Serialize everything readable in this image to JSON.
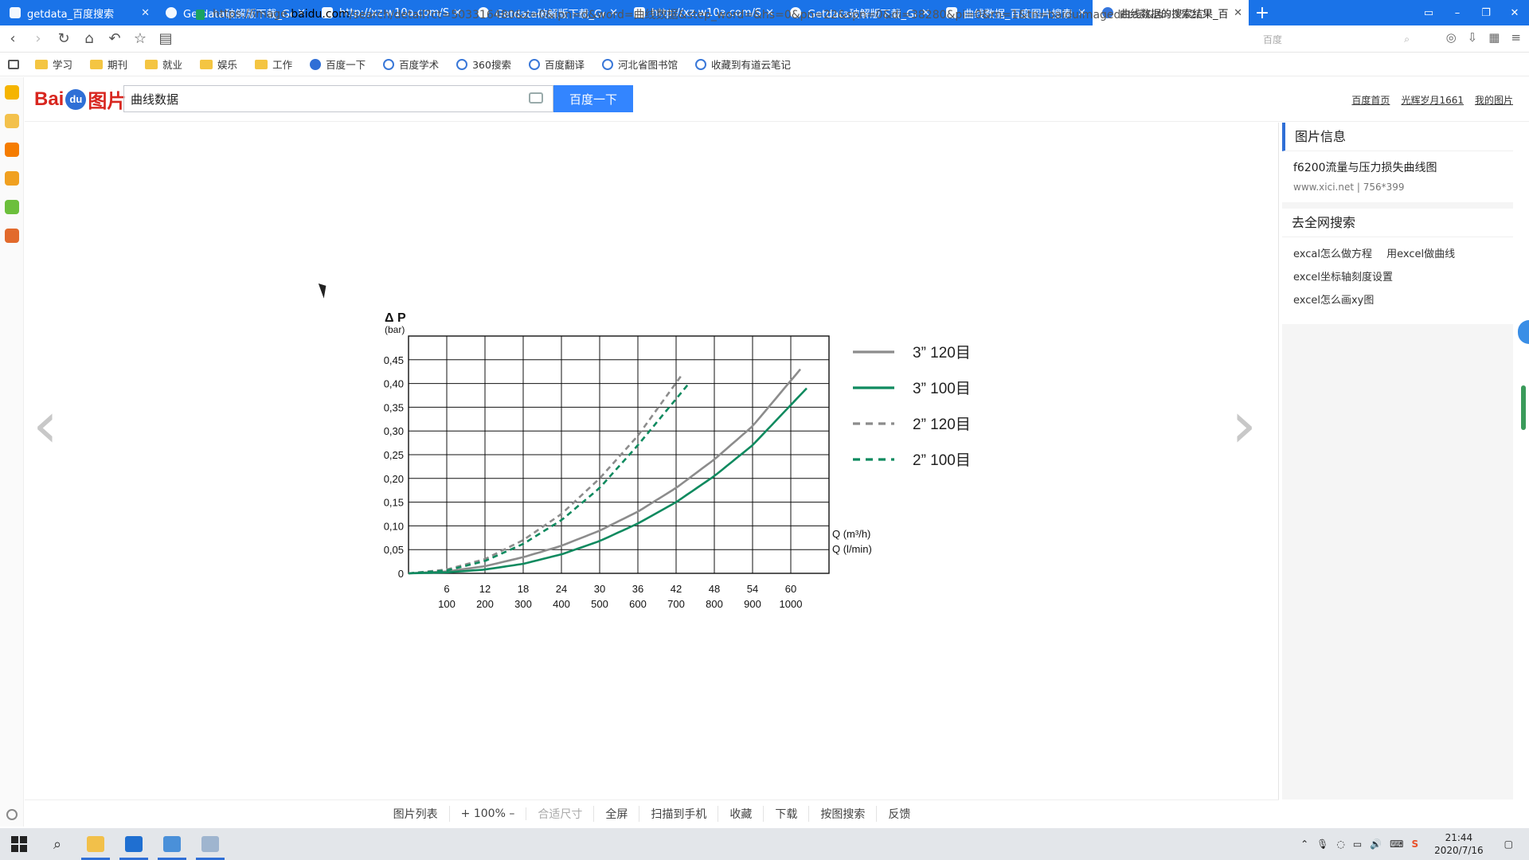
{
  "browser": {
    "tabs": [
      {
        "title": "getdata_百度搜索",
        "active": false
      },
      {
        "title": "Getdata破解版下载_Getd",
        "active": false
      },
      {
        "title": "http://xz.w10a.com/Small/g",
        "active": false
      },
      {
        "title": "Getdata破解版下载_Getd",
        "active": false
      },
      {
        "title": "http://xz.w10a.com/Small/g",
        "active": false
      },
      {
        "title": "Getdata破解版下载_Getd",
        "active": false
      },
      {
        "title": "曲线数据_百度图片搜索",
        "active": false
      },
      {
        "title": "曲线数据的搜索结果_百度",
        "active": true
      }
    ],
    "url_prefix": "https://image.",
    "url_domain": "baidu.com",
    "url_rest": "/search/detail?ct=503316480&z=0&ipn=d&word=曲线数据&step_word=&hs=0&pn=22&spn=0&di=38280&pi=0&rn=1&tn=baiduimagedetail&is=0%2C",
    "search_engine_box": "百度",
    "bookmarks": [
      "学习",
      "期刊",
      "就业",
      "娱乐",
      "工作",
      "百度一下",
      "百度学术",
      "360搜索",
      "百度翻译",
      "河北省图书馆",
      "收藏到有道云笔记"
    ]
  },
  "baidu": {
    "logo_bai": "Bai",
    "logo_du": "du",
    "logo_pic": "图片",
    "query": "曲线数据",
    "search_button": "百度一下",
    "links": [
      "百度首页",
      "光辉岁月1661",
      "我的图片"
    ]
  },
  "info_panel": {
    "title": "图片信息",
    "description": "f6200流量与压力损失曲线图",
    "source": "www.xici.net",
    "size": "756*399",
    "web_search_title": "去全网搜索",
    "suggestions": [
      [
        "excal怎么做方程",
        "用excel做曲线"
      ],
      [
        "excel坐标轴刻度设置"
      ],
      [
        "excel怎么画xy图"
      ]
    ]
  },
  "viewer_toolbar": [
    "图片列表",
    "+ 100% –",
    "合适尺寸",
    "全屏",
    "扫描到手机",
    "收藏",
    "下载",
    "按图搜索",
    "反馈"
  ],
  "taskbar": {
    "time": "21:44",
    "date": "2020/7/16"
  },
  "colors": {
    "tab_bar": "#1a73e8",
    "accent": "#3385ff",
    "gray_series": "#8c8c8c",
    "green_series": "#0f8a5f"
  },
  "chart_data": {
    "type": "line",
    "ylabel_symbol": "Δ P",
    "ylabel_unit": "(bar)",
    "yticks": [
      "0",
      "0,05",
      "0,10",
      "0,15",
      "0,20",
      "0,25",
      "0,30",
      "0,35",
      "0,40",
      "0,45"
    ],
    "ylim": [
      0,
      0.5
    ],
    "x_primary_ticks": [
      "6",
      "12",
      "18",
      "24",
      "30",
      "36",
      "42",
      "48",
      "54",
      "60"
    ],
    "x_primary_label": "Q (m³/h)",
    "x_secondary_ticks": [
      "100",
      "200",
      "300",
      "400",
      "500",
      "600",
      "700",
      "800",
      "900",
      "1000"
    ],
    "x_secondary_label": "Q (l/min)",
    "xlim": [
      0,
      66
    ],
    "grid": true,
    "legend_position": "right",
    "series": [
      {
        "name": "3” 120目",
        "color": "#8c8c8c",
        "style": "solid",
        "x": [
          0,
          6,
          12,
          18,
          24,
          30,
          36,
          42,
          48,
          54,
          61.5
        ],
        "y": [
          0,
          0.004,
          0.015,
          0.034,
          0.058,
          0.09,
          0.13,
          0.18,
          0.24,
          0.31,
          0.43
        ]
      },
      {
        "name": "3” 100目",
        "color": "#0f8a5f",
        "style": "solid",
        "x": [
          0,
          6,
          12,
          18,
          24,
          30,
          36,
          42,
          48,
          54,
          62.5
        ],
        "y": [
          0,
          0.002,
          0.008,
          0.02,
          0.04,
          0.068,
          0.105,
          0.15,
          0.205,
          0.27,
          0.39
        ]
      },
      {
        "name": "2” 120目",
        "color": "#8c8c8c",
        "style": "dashed",
        "x": [
          0,
          6,
          12,
          18,
          24,
          30,
          36,
          43
        ],
        "y": [
          0,
          0.008,
          0.03,
          0.07,
          0.125,
          0.2,
          0.29,
          0.42
        ]
      },
      {
        "name": "2” 100目",
        "color": "#0f8a5f",
        "style": "dashed",
        "x": [
          0,
          6,
          12,
          18,
          24,
          30,
          36,
          44
        ],
        "y": [
          0,
          0.006,
          0.026,
          0.062,
          0.112,
          0.18,
          0.27,
          0.4
        ]
      }
    ]
  }
}
